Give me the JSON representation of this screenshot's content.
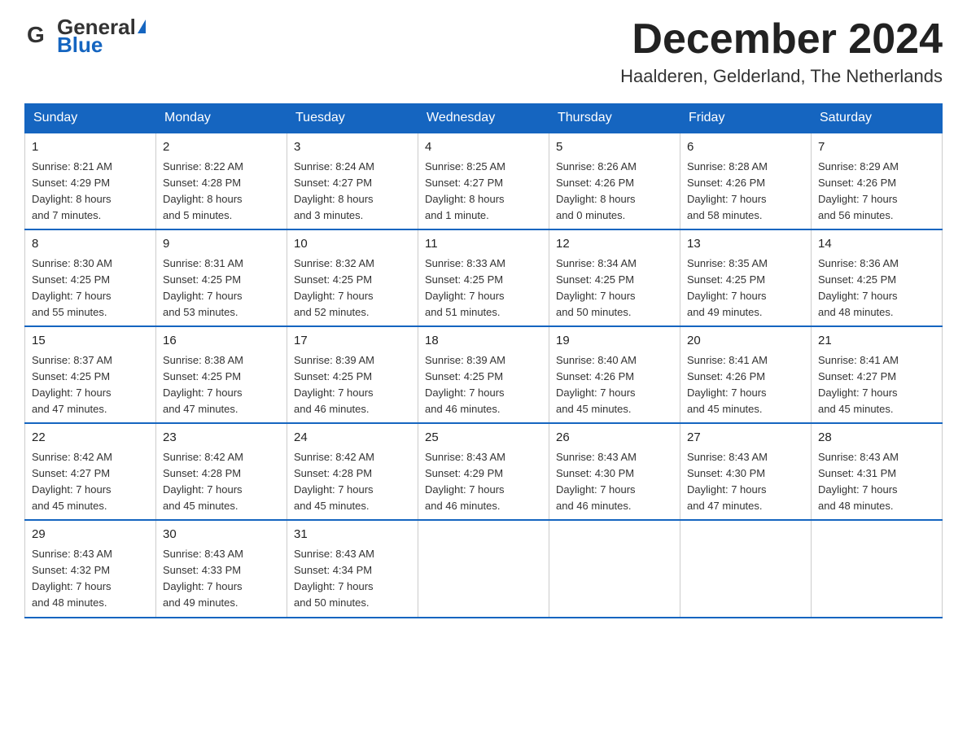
{
  "header": {
    "title": "December 2024",
    "location": "Haalderen, Gelderland, The Netherlands",
    "logo_general": "General",
    "logo_blue": "Blue"
  },
  "weekdays": [
    "Sunday",
    "Monday",
    "Tuesday",
    "Wednesday",
    "Thursday",
    "Friday",
    "Saturday"
  ],
  "weeks": [
    [
      {
        "day": "1",
        "sunrise": "8:21 AM",
        "sunset": "4:29 PM",
        "daylight": "8 hours and 7 minutes."
      },
      {
        "day": "2",
        "sunrise": "8:22 AM",
        "sunset": "4:28 PM",
        "daylight": "8 hours and 5 minutes."
      },
      {
        "day": "3",
        "sunrise": "8:24 AM",
        "sunset": "4:27 PM",
        "daylight": "8 hours and 3 minutes."
      },
      {
        "day": "4",
        "sunrise": "8:25 AM",
        "sunset": "4:27 PM",
        "daylight": "8 hours and 1 minute."
      },
      {
        "day": "5",
        "sunrise": "8:26 AM",
        "sunset": "4:26 PM",
        "daylight": "8 hours and 0 minutes."
      },
      {
        "day": "6",
        "sunrise": "8:28 AM",
        "sunset": "4:26 PM",
        "daylight": "7 hours and 58 minutes."
      },
      {
        "day": "7",
        "sunrise": "8:29 AM",
        "sunset": "4:26 PM",
        "daylight": "7 hours and 56 minutes."
      }
    ],
    [
      {
        "day": "8",
        "sunrise": "8:30 AM",
        "sunset": "4:25 PM",
        "daylight": "7 hours and 55 minutes."
      },
      {
        "day": "9",
        "sunrise": "8:31 AM",
        "sunset": "4:25 PM",
        "daylight": "7 hours and 53 minutes."
      },
      {
        "day": "10",
        "sunrise": "8:32 AM",
        "sunset": "4:25 PM",
        "daylight": "7 hours and 52 minutes."
      },
      {
        "day": "11",
        "sunrise": "8:33 AM",
        "sunset": "4:25 PM",
        "daylight": "7 hours and 51 minutes."
      },
      {
        "day": "12",
        "sunrise": "8:34 AM",
        "sunset": "4:25 PM",
        "daylight": "7 hours and 50 minutes."
      },
      {
        "day": "13",
        "sunrise": "8:35 AM",
        "sunset": "4:25 PM",
        "daylight": "7 hours and 49 minutes."
      },
      {
        "day": "14",
        "sunrise": "8:36 AM",
        "sunset": "4:25 PM",
        "daylight": "7 hours and 48 minutes."
      }
    ],
    [
      {
        "day": "15",
        "sunrise": "8:37 AM",
        "sunset": "4:25 PM",
        "daylight": "7 hours and 47 minutes."
      },
      {
        "day": "16",
        "sunrise": "8:38 AM",
        "sunset": "4:25 PM",
        "daylight": "7 hours and 47 minutes."
      },
      {
        "day": "17",
        "sunrise": "8:39 AM",
        "sunset": "4:25 PM",
        "daylight": "7 hours and 46 minutes."
      },
      {
        "day": "18",
        "sunrise": "8:39 AM",
        "sunset": "4:25 PM",
        "daylight": "7 hours and 46 minutes."
      },
      {
        "day": "19",
        "sunrise": "8:40 AM",
        "sunset": "4:26 PM",
        "daylight": "7 hours and 45 minutes."
      },
      {
        "day": "20",
        "sunrise": "8:41 AM",
        "sunset": "4:26 PM",
        "daylight": "7 hours and 45 minutes."
      },
      {
        "day": "21",
        "sunrise": "8:41 AM",
        "sunset": "4:27 PM",
        "daylight": "7 hours and 45 minutes."
      }
    ],
    [
      {
        "day": "22",
        "sunrise": "8:42 AM",
        "sunset": "4:27 PM",
        "daylight": "7 hours and 45 minutes."
      },
      {
        "day": "23",
        "sunrise": "8:42 AM",
        "sunset": "4:28 PM",
        "daylight": "7 hours and 45 minutes."
      },
      {
        "day": "24",
        "sunrise": "8:42 AM",
        "sunset": "4:28 PM",
        "daylight": "7 hours and 45 minutes."
      },
      {
        "day": "25",
        "sunrise": "8:43 AM",
        "sunset": "4:29 PM",
        "daylight": "7 hours and 46 minutes."
      },
      {
        "day": "26",
        "sunrise": "8:43 AM",
        "sunset": "4:30 PM",
        "daylight": "7 hours and 46 minutes."
      },
      {
        "day": "27",
        "sunrise": "8:43 AM",
        "sunset": "4:30 PM",
        "daylight": "7 hours and 47 minutes."
      },
      {
        "day": "28",
        "sunrise": "8:43 AM",
        "sunset": "4:31 PM",
        "daylight": "7 hours and 48 minutes."
      }
    ],
    [
      {
        "day": "29",
        "sunrise": "8:43 AM",
        "sunset": "4:32 PM",
        "daylight": "7 hours and 48 minutes."
      },
      {
        "day": "30",
        "sunrise": "8:43 AM",
        "sunset": "4:33 PM",
        "daylight": "7 hours and 49 minutes."
      },
      {
        "day": "31",
        "sunrise": "8:43 AM",
        "sunset": "4:34 PM",
        "daylight": "7 hours and 50 minutes."
      },
      null,
      null,
      null,
      null
    ]
  ],
  "labels": {
    "sunrise": "Sunrise: ",
    "sunset": "Sunset: ",
    "daylight": "Daylight: "
  }
}
